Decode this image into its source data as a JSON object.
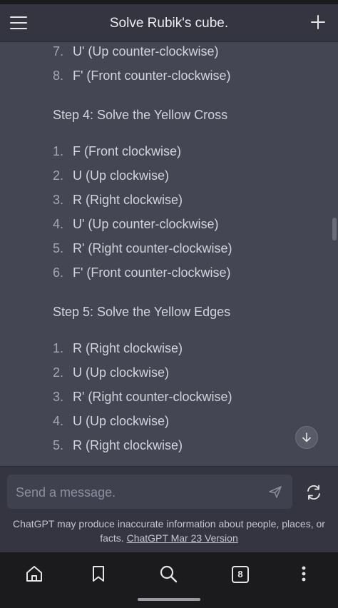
{
  "header": {
    "title": "Solve Rubik's cube."
  },
  "content": {
    "top_list": [
      {
        "num": "7.",
        "text": "U' (Up counter-clockwise)"
      },
      {
        "num": "8.",
        "text": "F' (Front counter-clockwise)"
      }
    ],
    "step4": {
      "heading": "Step 4: Solve the Yellow Cross",
      "items": [
        {
          "num": "1.",
          "text": "F (Front clockwise)"
        },
        {
          "num": "2.",
          "text": "U (Up clockwise)"
        },
        {
          "num": "3.",
          "text": "R (Right clockwise)"
        },
        {
          "num": "4.",
          "text": "U' (Up counter-clockwise)"
        },
        {
          "num": "5.",
          "text": "R' (Right counter-clockwise)"
        },
        {
          "num": "6.",
          "text": "F' (Front counter-clockwise)"
        }
      ]
    },
    "step5": {
      "heading": "Step 5: Solve the Yellow Edges",
      "items": [
        {
          "num": "1.",
          "text": "R (Right clockwise)"
        },
        {
          "num": "2.",
          "text": "U (Up clockwise)"
        },
        {
          "num": "3.",
          "text": "R' (Right counter-clockwise)"
        },
        {
          "num": "4.",
          "text": "U (Up clockwise)"
        },
        {
          "num": "5.",
          "text": "R (Right clockwise)"
        }
      ]
    }
  },
  "composer": {
    "placeholder": "Send a message."
  },
  "disclaimer": {
    "text": "ChatGPT may produce inaccurate information about people, places, or facts.",
    "link": "ChatGPT Mar 23 Version"
  },
  "browser_nav": {
    "tab_count": "8"
  },
  "icons": {
    "menu": "hamburger-menu-icon",
    "new_chat": "plus-icon",
    "scroll_down": "arrow-down-icon",
    "send": "paper-plane-icon",
    "regenerate": "refresh-icon",
    "home": "home-icon",
    "bookmark": "bookmark-icon",
    "search": "search-icon",
    "more": "more-vertical-icon"
  },
  "colors": {
    "chat_background": "#444654",
    "header_background": "#343541",
    "text": "#d1d5db",
    "list_number": "#a4a7b0",
    "nav_background": "#1b1b1e"
  }
}
